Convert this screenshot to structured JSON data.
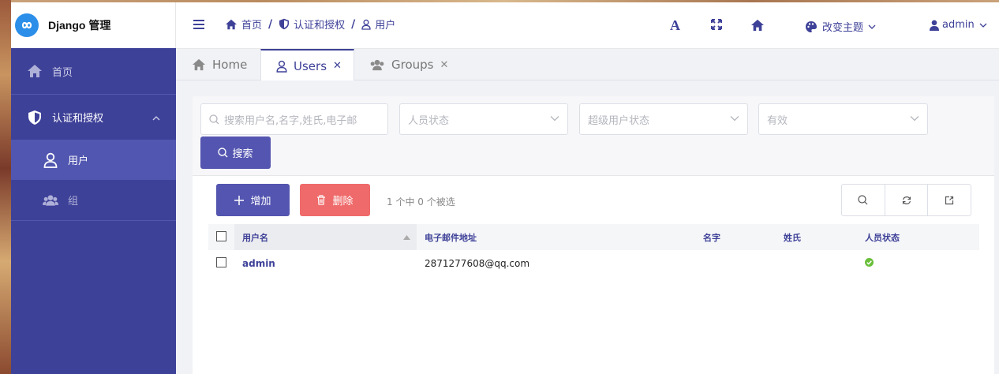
{
  "brand": {
    "title": "Django 管理",
    "accent": "#3e4198",
    "logo_color": "#2b8ee8"
  },
  "sidebar": {
    "items": [
      {
        "label": "首页",
        "icon": "home-icon"
      },
      {
        "label": "认证和授权",
        "icon": "shield-icon",
        "expanded": true,
        "children": [
          {
            "label": "用户",
            "icon": "user-icon",
            "active": true
          },
          {
            "label": "组",
            "icon": "users-icon",
            "active": false
          }
        ]
      }
    ]
  },
  "header": {
    "breadcrumb": [
      "首页",
      "认证和授权",
      "用户"
    ],
    "breadcrumb_sep": "/",
    "font_tool": "A",
    "theme_label": "改变主题",
    "user_label": "admin"
  },
  "tabs": [
    {
      "label": "Home",
      "icon": "home-icon",
      "closable": false,
      "active": false
    },
    {
      "label": "Users",
      "icon": "user-icon",
      "closable": true,
      "active": true
    },
    {
      "label": "Groups",
      "icon": "users-icon",
      "closable": true,
      "active": false
    }
  ],
  "tab_close_glyph": "✕",
  "filters": {
    "search_placeholder": "搜索用户名,名字,姓氏,电子邮",
    "select1_placeholder": "人员状态",
    "select2_placeholder": "超级用户状态",
    "select3_placeholder": "有效",
    "search_button": "搜索"
  },
  "toolbar": {
    "add_label": "增加",
    "delete_label": "删除",
    "selection_text": "1 个中 0 个被选",
    "add_color": "#5355b0",
    "delete_color": "#ef6a6a"
  },
  "table": {
    "columns": [
      "用户名",
      "电子邮件地址",
      "名字",
      "姓氏",
      "人员状态"
    ],
    "rows": [
      {
        "username": "admin",
        "email": "2871277608@qq.com",
        "first_name": "",
        "last_name": "",
        "staff": true
      }
    ]
  }
}
